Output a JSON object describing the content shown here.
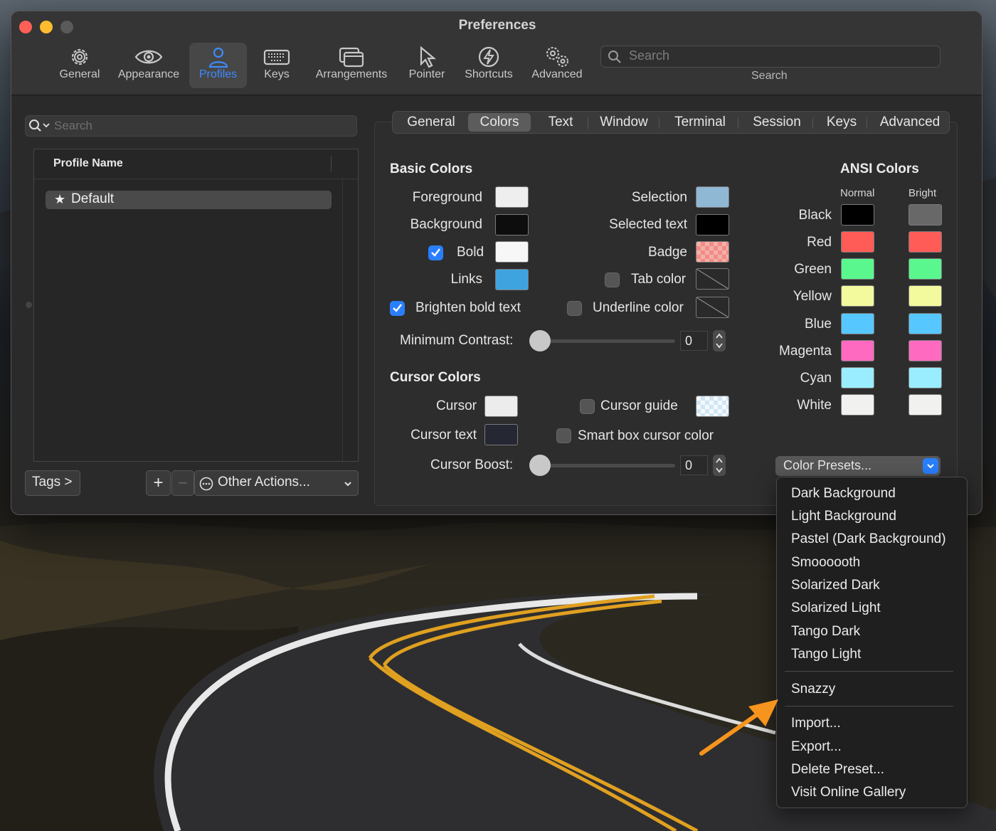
{
  "window": {
    "title": "Preferences"
  },
  "toolbar": {
    "items": [
      {
        "label": "General",
        "icon": "gear-icon"
      },
      {
        "label": "Appearance",
        "icon": "eye-icon"
      },
      {
        "label": "Profiles",
        "icon": "person-icon",
        "active": true
      },
      {
        "label": "Keys",
        "icon": "keyboard-icon"
      },
      {
        "label": "Arrangements",
        "icon": "windows-icon"
      },
      {
        "label": "Pointer",
        "icon": "pointer-icon"
      },
      {
        "label": "Shortcuts",
        "icon": "bolt-icon"
      },
      {
        "label": "Advanced",
        "icon": "gears-icon"
      }
    ],
    "search": {
      "placeholder": "Search",
      "label": "Search"
    }
  },
  "profiles": {
    "search_placeholder": "Search",
    "column_header": "Profile Name",
    "items": [
      {
        "name": "Default",
        "starred": true
      }
    ],
    "tags_label": "Tags >",
    "add_label": "+",
    "remove_label": "−",
    "other_actions_label": "Other Actions..."
  },
  "tabs": [
    {
      "label": "General"
    },
    {
      "label": "Colors",
      "active": true
    },
    {
      "label": "Text"
    },
    {
      "label": "Window"
    },
    {
      "label": "Terminal"
    },
    {
      "label": "Session"
    },
    {
      "label": "Keys"
    },
    {
      "label": "Advanced"
    }
  ],
  "basic_colors": {
    "title": "Basic Colors",
    "foreground": {
      "label": "Foreground",
      "color": "#eeeeee"
    },
    "background": {
      "label": "Background",
      "color": "#0d0d0d"
    },
    "bold": {
      "label": "Bold",
      "color": "#f7f7f7",
      "checked": true
    },
    "links": {
      "label": "Links",
      "color": "#3fa3df"
    },
    "selection": {
      "label": "Selection",
      "color": "#8fb8d4"
    },
    "selected_text": {
      "label": "Selected text",
      "color": "#000000"
    },
    "badge": {
      "label": "Badge",
      "color": "#f58a84"
    },
    "tab_color": {
      "label": "Tab color",
      "checked": false
    },
    "underline_color": {
      "label": "Underline color",
      "checked": false
    },
    "brighten_bold": {
      "label": "Brighten bold text",
      "checked": true
    },
    "min_contrast": {
      "label": "Minimum Contrast:",
      "value": "0"
    }
  },
  "cursor_colors": {
    "title": "Cursor Colors",
    "cursor": {
      "label": "Cursor",
      "color": "#ececec"
    },
    "cursor_text": {
      "label": "Cursor text",
      "color": "#252733"
    },
    "cursor_guide": {
      "label": "Cursor guide",
      "checked": false
    },
    "smart_box": {
      "label": "Smart box cursor color",
      "checked": false
    },
    "boost": {
      "label": "Cursor Boost:",
      "value": "0"
    }
  },
  "ansi": {
    "title": "ANSI Colors",
    "normal_label": "Normal",
    "bright_label": "Bright",
    "rows": [
      {
        "name": "Black",
        "normal": "#000000",
        "bright": "#686868"
      },
      {
        "name": "Red",
        "normal": "#ff5c57",
        "bright": "#ff5c57"
      },
      {
        "name": "Green",
        "normal": "#5af78e",
        "bright": "#5af78e"
      },
      {
        "name": "Yellow",
        "normal": "#f3f99d",
        "bright": "#f3f99d"
      },
      {
        "name": "Blue",
        "normal": "#57c7ff",
        "bright": "#57c7ff"
      },
      {
        "name": "Magenta",
        "normal": "#ff6ac1",
        "bright": "#ff6ac1"
      },
      {
        "name": "Cyan",
        "normal": "#9aedfe",
        "bright": "#9aedfe"
      },
      {
        "name": "White",
        "normal": "#f1f1f0",
        "bright": "#f1f1f0"
      }
    ]
  },
  "color_presets": {
    "button_label": "Color Presets...",
    "menu_items": [
      "Dark Background",
      "Light Background",
      "Pastel (Dark Background)",
      "Smoooooth",
      "Solarized Dark",
      "Solarized Light",
      "Tango Dark",
      "Tango Light"
    ],
    "custom_items": [
      "Snazzy"
    ],
    "action_items": [
      "Import...",
      "Export...",
      "Delete Preset...",
      "Visit Online Gallery"
    ]
  },
  "colors": {
    "accent": "#2a7fff",
    "arrow": "#f7941d",
    "active_toolbar": "#3d8bff"
  }
}
